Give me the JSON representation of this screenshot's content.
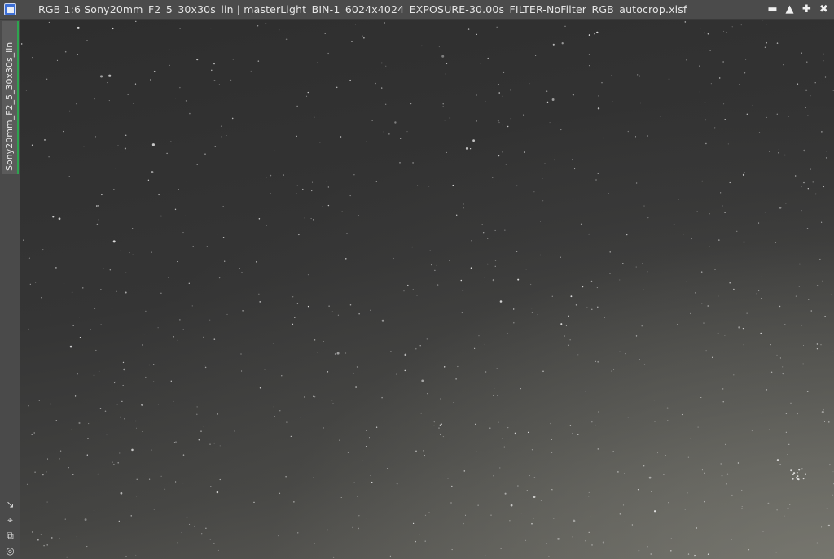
{
  "window": {
    "title": "RGB 1:6 Sony20mm_F2_5_30x30s_lin | masterLight_BIN-1_6024x4024_EXPOSURE-30.00s_FILTER-NoFilter_RGB_autocrop.xisf",
    "buttons": {
      "shade": "▬",
      "collapse": "▲",
      "maximize": "✚",
      "close": "✖"
    }
  },
  "side_panel": {
    "tab_label": "Sony20mm_F2_5_30x30s_lin",
    "accent_color": "#2ea44f",
    "tools": [
      {
        "icon": "↘",
        "name": "zoom-fit-icon"
      },
      {
        "icon": "⌖",
        "name": "crosshair-icon"
      },
      {
        "icon": "⧉",
        "name": "clone-icon"
      },
      {
        "icon": "◎",
        "name": "target-icon"
      }
    ]
  },
  "image": {
    "description_color_dark": "#2e2e2e",
    "description_color_light": "#5e5d58"
  }
}
